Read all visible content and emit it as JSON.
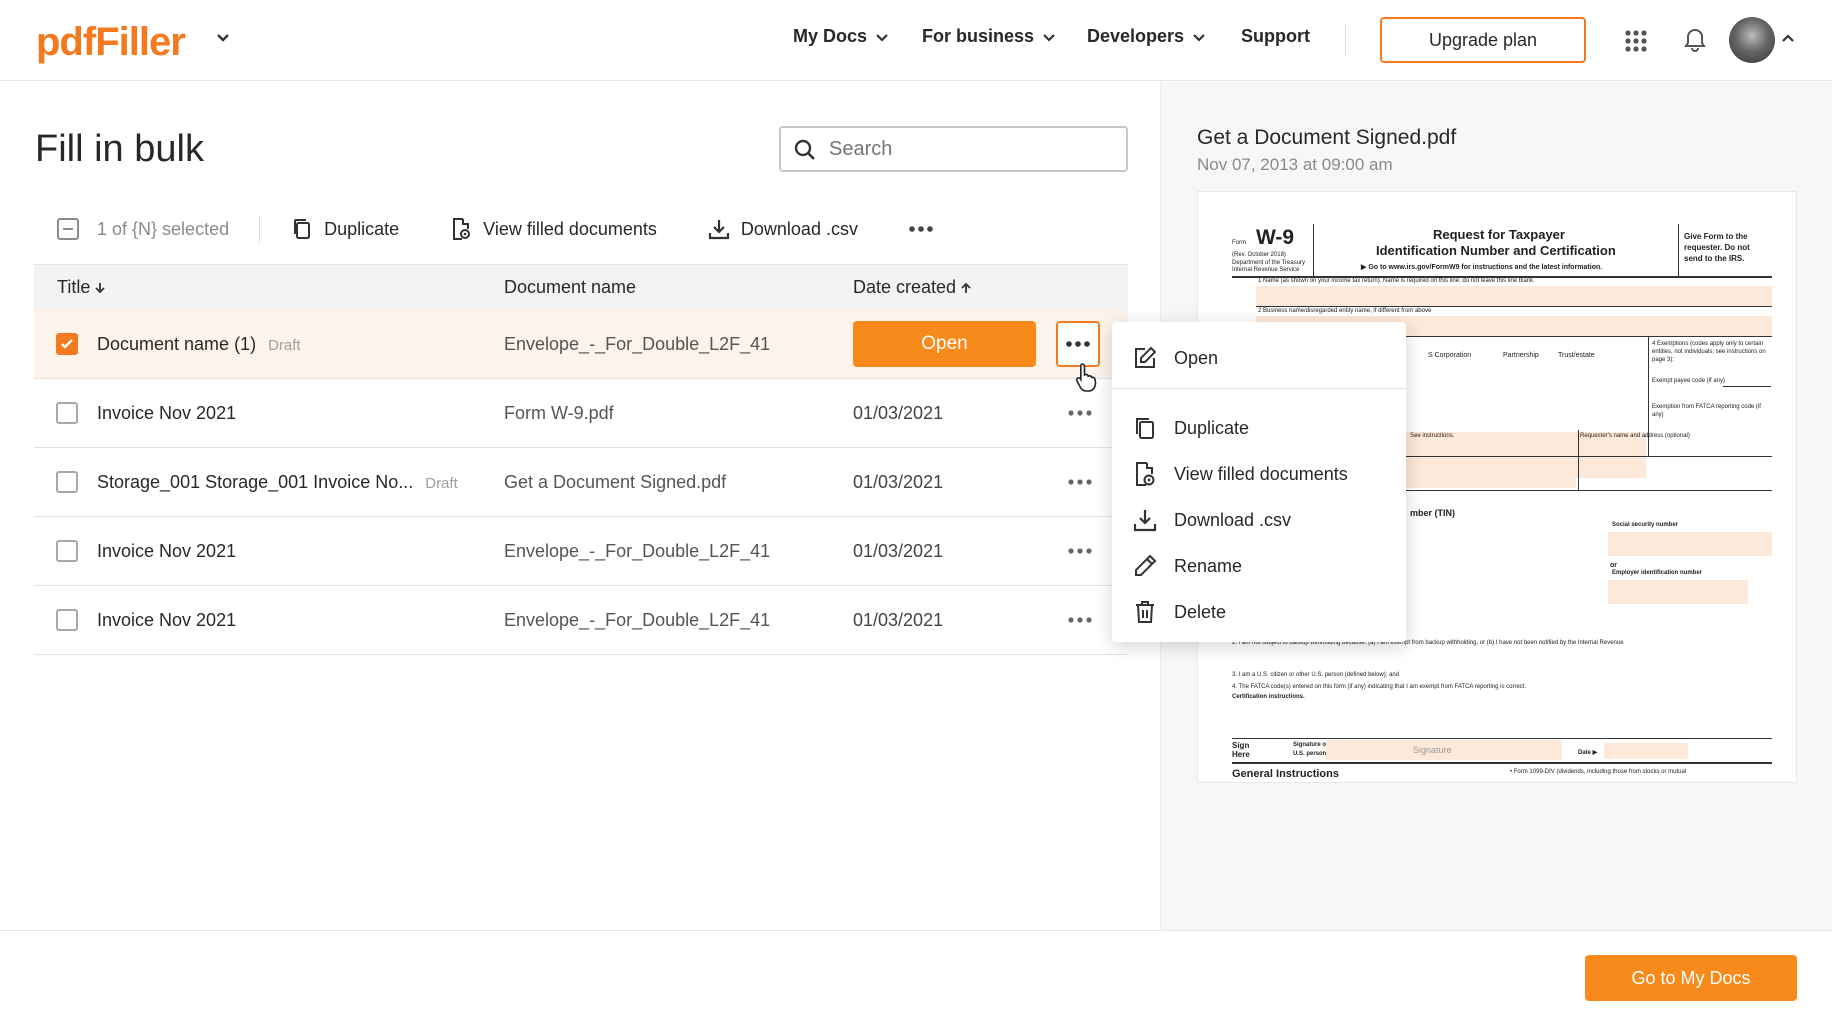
{
  "header": {
    "logo": "pdfFiller",
    "nav": [
      {
        "label": "My Docs"
      },
      {
        "label": "For business"
      },
      {
        "label": "Developers"
      },
      {
        "label": "Support"
      }
    ],
    "upgrade_label": "Upgrade plan"
  },
  "page": {
    "title": "Fill in bulk",
    "search_placeholder": "Search"
  },
  "toolbar": {
    "selected_text": "1 of {N} selected",
    "duplicate": "Duplicate",
    "view_filled": "View filled documents",
    "download_csv": "Download .csv"
  },
  "table": {
    "columns": {
      "title": "Title",
      "document_name": "Document name",
      "date_created": "Date created"
    },
    "rows": [
      {
        "title": "Document name (1)",
        "badge": "Draft",
        "doc": "Envelope_-_For_Double_L2F_41",
        "date": "",
        "open_label": "Open",
        "selected": true
      },
      {
        "title": "Invoice Nov 2021",
        "badge": "",
        "doc": "Form W-9.pdf",
        "date": "01/03/2021",
        "selected": false
      },
      {
        "title": "Storage_001 Storage_001 Invoice No...",
        "badge": "Draft",
        "doc": "Get a Document Signed.pdf",
        "date": "01/03/2021",
        "selected": false
      },
      {
        "title": "Invoice Nov 2021",
        "badge": "",
        "doc": "Envelope_-_For_Double_L2F_41",
        "date": "01/03/2021",
        "selected": false
      },
      {
        "title": "Invoice Nov 2021",
        "badge": "",
        "doc": "Envelope_-_For_Double_L2F_41",
        "date": "01/03/2021",
        "selected": false
      }
    ]
  },
  "context_menu": {
    "items": [
      {
        "label": "Open",
        "icon": "edit-icon"
      },
      {
        "label": "Duplicate",
        "icon": "duplicate-icon"
      },
      {
        "label": "View filled documents",
        "icon": "view-filled-icon"
      },
      {
        "label": "Download .csv",
        "icon": "download-icon"
      },
      {
        "label": "Rename",
        "icon": "pencil-icon"
      },
      {
        "label": "Delete",
        "icon": "trash-icon"
      }
    ]
  },
  "preview": {
    "title": "Get a Document Signed.pdf",
    "date": "Nov 07, 2013 at 09:00 am",
    "form": {
      "form_label": "Form",
      "form_number": "W-9",
      "rev": "(Rev. October 2018)",
      "dept": "Department of the Treasury",
      "irs": "Internal Revenue Service",
      "heading1": "Request for Taxpayer",
      "heading2": "Identification Number and Certification",
      "goto": "▶ Go to www.irs.gov/FormW9 for instructions and the latest information.",
      "give1": "Give Form to the",
      "give2": "requester. Do not",
      "give3": "send to the IRS.",
      "line1": "1 Name (as shown on your income tax return). Name is required on this line; do not leave this line blank.",
      "line2": "2 Business name/disregarded entity name, if different from above",
      "corp": "S Corporation",
      "partnership": "Partnership",
      "trust": "Trust/estate",
      "exemptions": "4 Exemptions (codes apply only to certain entities, not individuals; see instructions on page 3):",
      "exempt_payee": "Exempt payee code (if any)",
      "fatca": "Exemption from FATCA reporting code (if any)",
      "see_instr": "See instructions.",
      "requester": "Requester's name and address (optional)",
      "tin": "mber (TIN)",
      "ssn": "Social security number",
      "or": "or",
      "ein": "Employer identification number",
      "cert2": "2. I am not subject to backup withholding because: (a) I am exempt from backup withholding, or (b) I have not been notified by the Internal Revenue",
      "cert3": "3. I am a U.S. citizen or other U.S. person (defined below); and",
      "cert4": "4. The FATCA code(s) entered on this form (if any) indicating that I am exempt from FATCA reporting is correct.",
      "cert_instr": "Certification instructions.",
      "sign": "Sign",
      "here": "Here",
      "sig_of": "Signature of",
      "us_person": "U.S. person ▶",
      "signature": "Signature",
      "date_lbl": "Date ▶",
      "general": "General Instructions",
      "form1099": "• Form 1099-DIV (dividends, including those from stocks or mutual"
    }
  },
  "footer": {
    "go_label": "Go to My Docs"
  },
  "colors": {
    "accent": "#f37a1f",
    "button": "#f88a1c",
    "selected_row": "#fdf3ea"
  }
}
